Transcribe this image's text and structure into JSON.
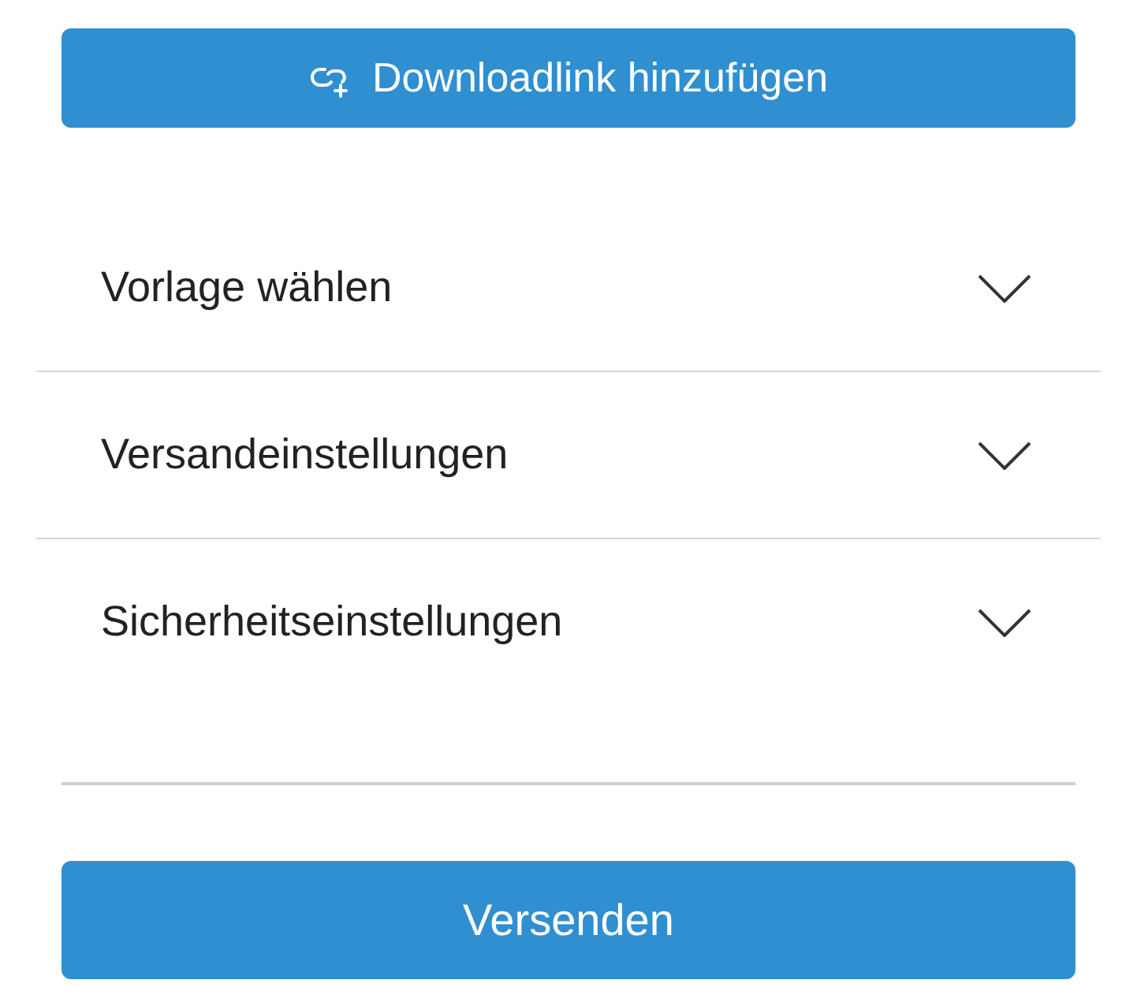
{
  "add_link_button": {
    "label": "Downloadlink hinzufügen"
  },
  "sections": [
    {
      "title": "Vorlage wählen",
      "expanded": false
    },
    {
      "title": "Versandeinstellungen",
      "expanded": false
    },
    {
      "title": "Sicherheitseinstellungen",
      "expanded": false
    }
  ],
  "send_button": {
    "label": "Versenden"
  }
}
